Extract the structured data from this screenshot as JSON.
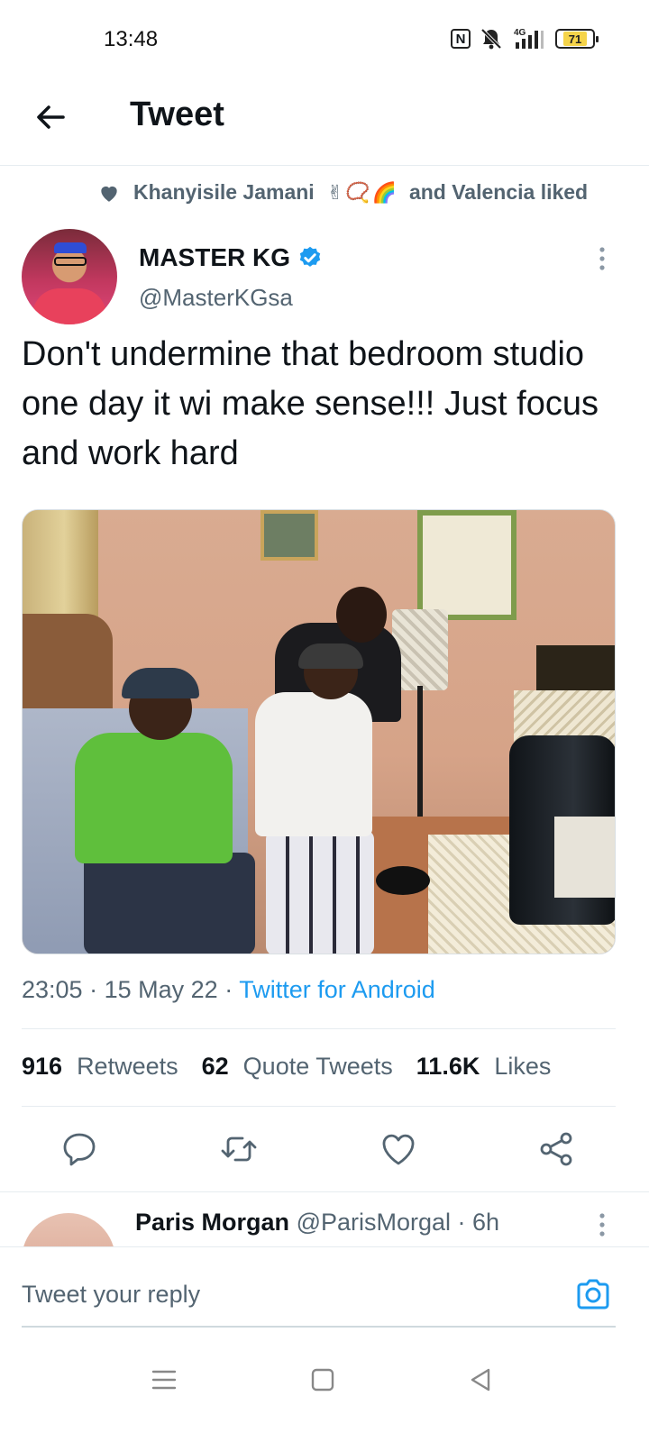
{
  "status_bar": {
    "time": "13:48",
    "network": "4G",
    "battery_level": "71",
    "icons": [
      "nfc-icon",
      "mute-icon",
      "signal-icon",
      "battery-icon"
    ]
  },
  "header": {
    "title": "Tweet",
    "back_icon": "back-arrow-icon"
  },
  "social_context": {
    "icon": "heart-icon",
    "name": "Khanyisile Jamani",
    "emojis": [
      "✌",
      "📿",
      "🌈"
    ],
    "suffix": "and Valencia liked"
  },
  "tweet": {
    "author_name": "MASTER KG",
    "verified": true,
    "author_handle": "@MasterKGsa",
    "text": "Don't undermine that bedroom studio one day it wi make sense!!! Just focus and work hard",
    "time": "23:05",
    "date": "15 May 22",
    "source": "Twitter for Android",
    "stats": {
      "retweets_count": "916",
      "retweets_label": "Retweets",
      "quotes_count": "62",
      "quotes_label": "Quote Tweets",
      "likes_count": "11.6K",
      "likes_label": "Likes"
    }
  },
  "actions": [
    "reply-icon",
    "retweet-icon",
    "like-icon",
    "share-icon"
  ],
  "reply_preview": {
    "name": "Paris Morgan",
    "handle": "@ParisMorgal",
    "age": "6h"
  },
  "compose": {
    "placeholder": "Tweet your reply",
    "camera_icon": "camera-icon"
  },
  "colors": {
    "accent": "#1d9bf0",
    "text_primary": "#0f1419",
    "text_secondary": "#536471",
    "divider": "#e6ecf0"
  }
}
